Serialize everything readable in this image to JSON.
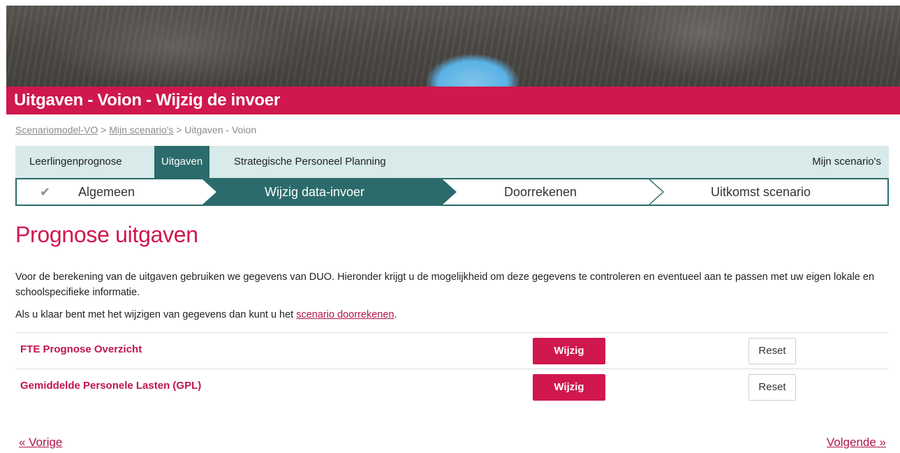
{
  "page": {
    "title": "Uitgaven - Voion - Wijzig de invoer"
  },
  "breadcrumb": {
    "items": [
      "Scenariomodel-VO",
      "Mijn scenario's"
    ],
    "separator": ">",
    "current": "Uitgaven - Voion"
  },
  "tabs": [
    {
      "label": "Leerlingenprognose",
      "active": false
    },
    {
      "label": "Uitgaven",
      "active": true
    },
    {
      "label": "Strategische Personeel Planning",
      "active": false
    }
  ],
  "tabs_right": {
    "label": "Mijn scenario's"
  },
  "steps": [
    {
      "label": "Algemeen",
      "state": "done",
      "icon": "check-icon"
    },
    {
      "label": "Wijzig data-invoer",
      "state": "active"
    },
    {
      "label": "Doorrekenen",
      "state": "todo"
    },
    {
      "label": "Uitkomst scenario",
      "state": "todo"
    }
  ],
  "content": {
    "heading": "Prognose uitgaven",
    "intro": "Voor de berekening van de uitgaven gebruiken we gegevens van DUO. Hieronder krijgt u de mogelijkheid om deze gegevens te controleren en eventueel aan te passen met uw eigen lokale en schoolspecifieke informatie.",
    "intro2_before": "Als u klaar bent met het wijzigen van gegevens dan kunt u het ",
    "intro2_link": "scenario doorrekenen",
    "intro2_after": "."
  },
  "rows": [
    {
      "label": "FTE Prognose Overzicht",
      "edit": "Wijzig",
      "reset": "Reset"
    },
    {
      "label": "Gemiddelde Personele Lasten (GPL)",
      "edit": "Wijzig",
      "reset": "Reset"
    }
  ],
  "pager": {
    "prev": "« Vorige",
    "next": "Volgende »"
  },
  "colors": {
    "brand": "#d0174e",
    "teal": "#2b6b6b",
    "tab_bg": "#d8eaea"
  }
}
